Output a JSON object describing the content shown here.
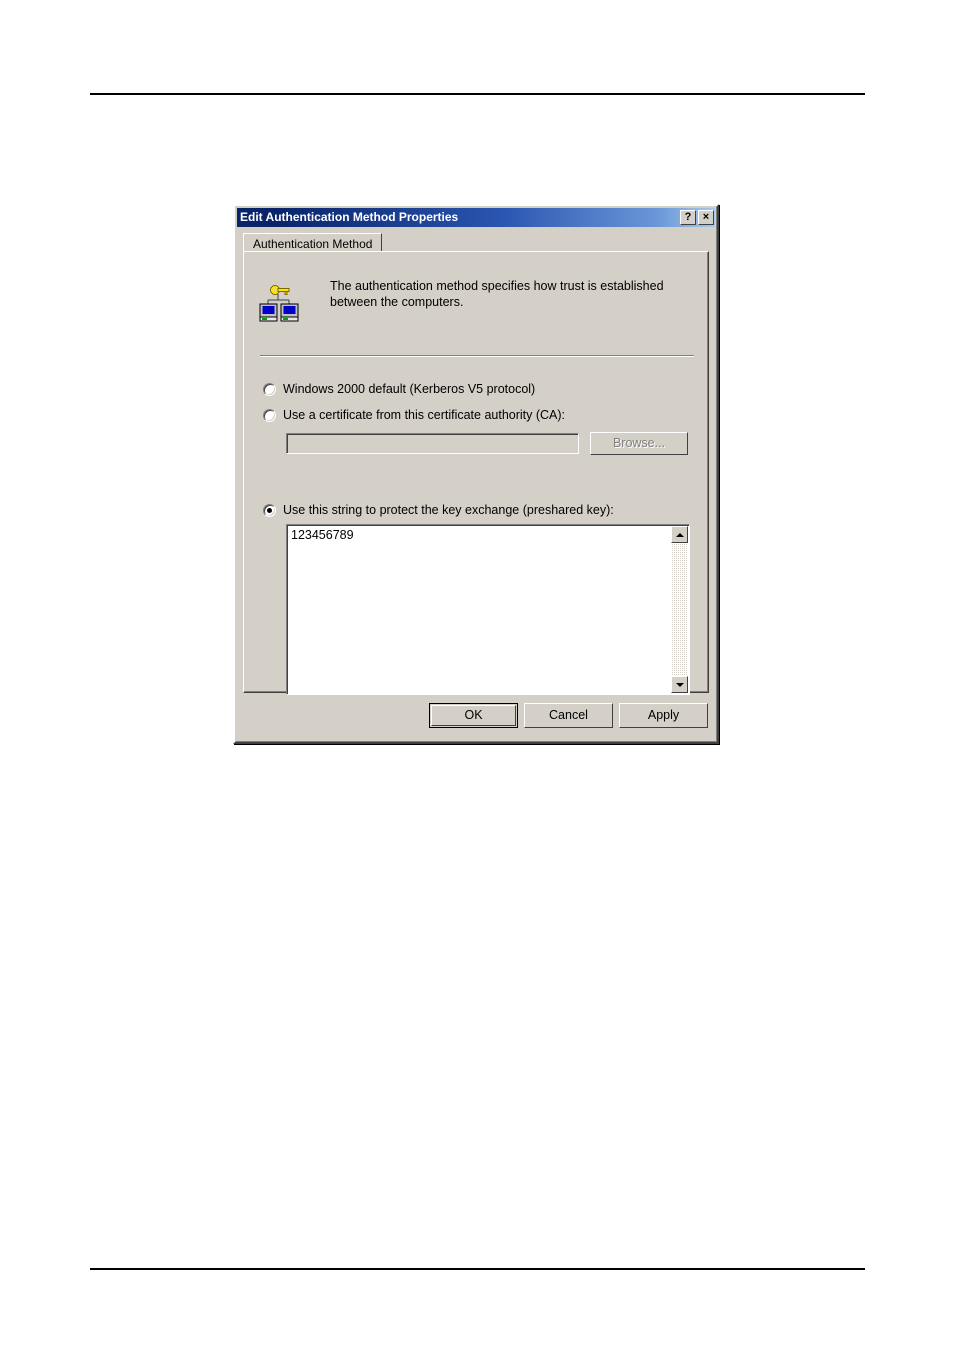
{
  "page": {
    "background": "#ffffff",
    "rules": {
      "top": "horizontal-rule",
      "bottom": "horizontal-rule"
    }
  },
  "dialog": {
    "title": "Edit Authentication Method Properties",
    "titlebar_colors": {
      "left": "#0a246a",
      "right": "#a6c8ea"
    },
    "face_color": "#d4d0c8",
    "help_button": "?",
    "close_button": "×",
    "tabs": [
      {
        "label": "Authentication Method",
        "selected": true
      }
    ],
    "description": {
      "icon": "two-computers-key-icon",
      "text": "The authentication method specifies how trust is established between the computers."
    },
    "options": [
      {
        "id": "kerberos",
        "label": "Windows 2000 default (Kerberos V5 protocol)",
        "checked": false
      },
      {
        "id": "certificate",
        "label": "Use a certificate from this certificate authority (CA):",
        "checked": false
      },
      {
        "id": "preshared-key",
        "label": "Use this string to protect the key exchange (preshared key):",
        "checked": true
      }
    ],
    "ca_field": {
      "value": "",
      "placeholder": "",
      "enabled": false
    },
    "browse_button": {
      "label": "Browse...",
      "enabled": false
    },
    "preshared_key_field": {
      "value": "123456789",
      "enabled": true,
      "scrollbar": {
        "up_arrow": "scroll-up-arrow",
        "down_arrow": "scroll-down-arrow"
      }
    },
    "buttons": [
      {
        "id": "ok",
        "label": "OK",
        "default": true
      },
      {
        "id": "cancel",
        "label": "Cancel",
        "default": false
      },
      {
        "id": "apply",
        "label": "Apply",
        "default": false
      }
    ]
  }
}
